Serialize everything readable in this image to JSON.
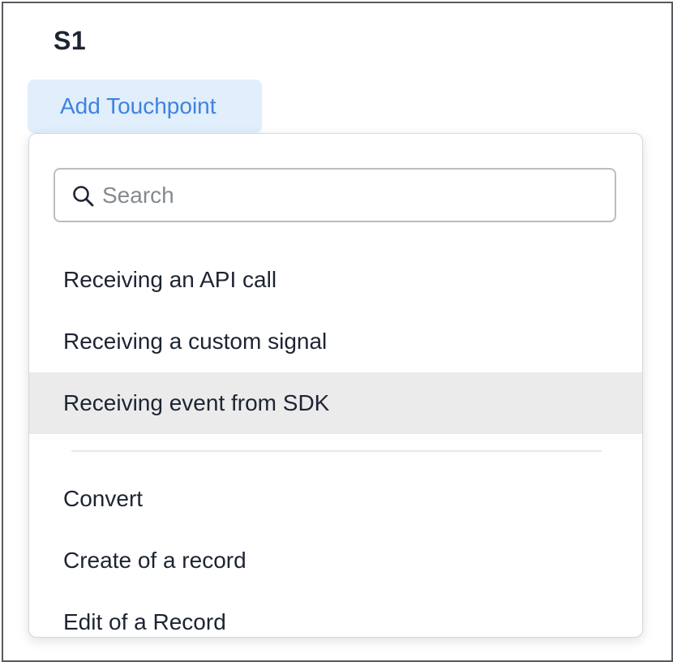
{
  "section": {
    "title": "S1"
  },
  "add_button": {
    "label": "Add Touchpoint"
  },
  "dropdown": {
    "search": {
      "placeholder": "Search",
      "value": ""
    },
    "groups": [
      {
        "items": [
          {
            "label": "Receiving an API call"
          },
          {
            "label": "Receiving a custom signal"
          },
          {
            "label": "Receiving event from SDK",
            "highlighted": true
          }
        ]
      },
      {
        "items": [
          {
            "label": "Convert"
          },
          {
            "label": "Create of a record"
          },
          {
            "label": "Edit of a Record"
          }
        ]
      }
    ]
  },
  "colors": {
    "accent": "#3e83e0",
    "accent_bg": "#e1eefc",
    "text": "#1d2432",
    "hover_bg": "#ebebeb"
  }
}
